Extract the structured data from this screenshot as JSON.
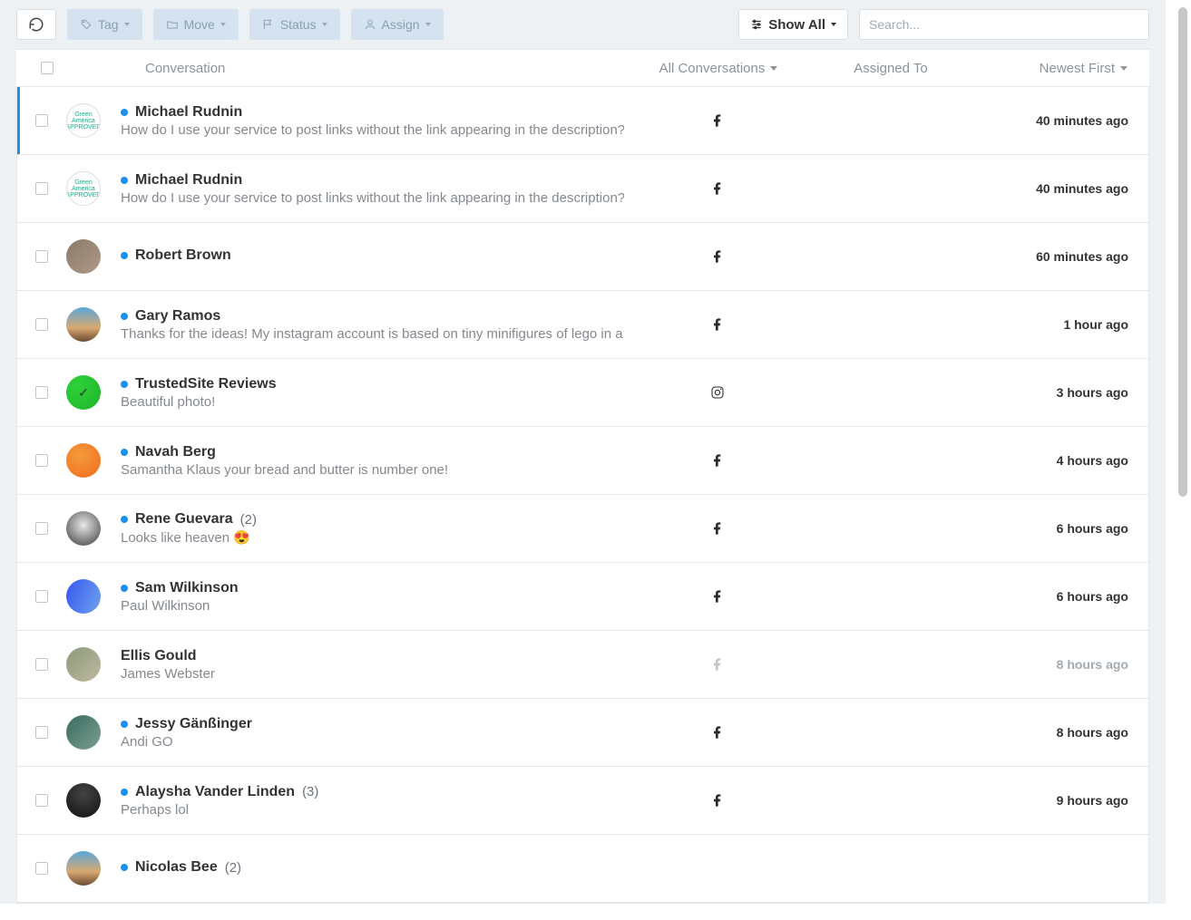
{
  "toolbar": {
    "tag_label": "Tag",
    "move_label": "Move",
    "status_label": "Status",
    "assign_label": "Assign",
    "showall_label": "Show All",
    "search_placeholder": "Search..."
  },
  "headers": {
    "conversation": "Conversation",
    "filter": "All Conversations",
    "assigned_to": "Assigned To",
    "sort": "Newest First"
  },
  "rows": [
    {
      "selected": true,
      "unread": true,
      "avatar_style": "green-logo",
      "avatar_text": "Green America APPROVED",
      "name": "Michael Rudnin",
      "count": "",
      "preview": "How do I use your service to post links without the link appearing in the description? That is, w",
      "channel": "facebook",
      "time": "40 minutes ago",
      "muted": false
    },
    {
      "selected": false,
      "unread": true,
      "avatar_style": "green-logo",
      "avatar_text": "Green America APPROVED",
      "name": "Michael Rudnin",
      "count": "",
      "preview": "How do I use your service to post links without the link appearing in the description? That is, w",
      "channel": "facebook",
      "time": "40 minutes ago",
      "muted": false
    },
    {
      "selected": false,
      "unread": true,
      "avatar_style": "photo1",
      "avatar_text": "",
      "name": "Robert Brown",
      "count": "",
      "preview": "",
      "channel": "facebook",
      "time": "60 minutes ago",
      "muted": false
    },
    {
      "selected": false,
      "unread": true,
      "avatar_style": "sky",
      "avatar_text": "",
      "name": "Gary Ramos",
      "count": "",
      "preview": "Thanks for the ideas! My instagram account is based on tiny minifigures of lego in a real life si",
      "channel": "facebook",
      "time": "1 hour ago",
      "muted": false
    },
    {
      "selected": false,
      "unread": true,
      "avatar_style": "green",
      "avatar_text": "✓",
      "name": "TrustedSite Reviews",
      "count": "",
      "preview": "Beautiful photo!",
      "channel": "instagram",
      "time": "3 hours ago",
      "muted": false
    },
    {
      "selected": false,
      "unread": true,
      "avatar_style": "orange",
      "avatar_text": "",
      "name": "Navah Berg",
      "count": "",
      "preview": "Samantha Klaus your bread and butter is number one!",
      "channel": "facebook",
      "time": "4 hours ago",
      "muted": false
    },
    {
      "selected": false,
      "unread": true,
      "avatar_style": "bw",
      "avatar_text": "",
      "name": "Rene Guevara",
      "count": "(2)",
      "preview": "Looks like heaven 😍",
      "channel": "facebook",
      "time": "6 hours ago",
      "muted": false
    },
    {
      "selected": false,
      "unread": true,
      "avatar_style": "blue",
      "avatar_text": "",
      "name": "Sam Wilkinson",
      "count": "",
      "preview": "Paul Wilkinson",
      "channel": "facebook",
      "time": "6 hours ago",
      "muted": false
    },
    {
      "selected": false,
      "unread": false,
      "avatar_style": "group",
      "avatar_text": "",
      "name": "Ellis Gould",
      "count": "",
      "preview": "James Webster",
      "channel": "facebook",
      "time": "8 hours ago",
      "muted": true
    },
    {
      "selected": false,
      "unread": true,
      "avatar_style": "teal",
      "avatar_text": "",
      "name": "Jessy Gänßinger",
      "count": "",
      "preview": "Andi GO",
      "channel": "facebook",
      "time": "8 hours ago",
      "muted": false
    },
    {
      "selected": false,
      "unread": true,
      "avatar_style": "dark",
      "avatar_text": "",
      "name": "Alaysha Vander Linden",
      "count": "(3)",
      "preview": "Perhaps lol",
      "channel": "facebook",
      "time": "9 hours ago",
      "muted": false
    },
    {
      "selected": false,
      "unread": true,
      "avatar_style": "sky",
      "avatar_text": "",
      "name": "Nicolas Bee",
      "count": "(2)",
      "preview": "",
      "channel": "",
      "time": "",
      "muted": false
    }
  ]
}
